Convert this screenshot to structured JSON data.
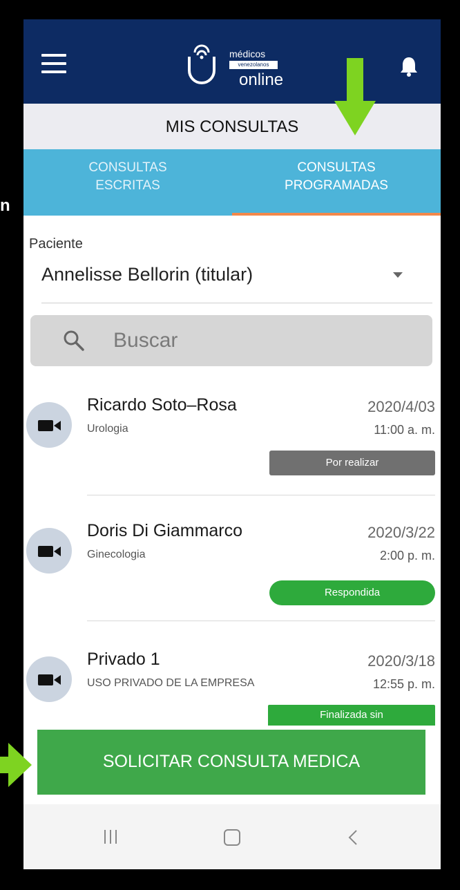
{
  "header": {
    "logo_line1": "médicos",
    "logo_badge": "venezolanos",
    "logo_line2": "online",
    "menu_icon": "hamburger-menu-icon",
    "bell_icon": "notification-bell-icon"
  },
  "page_title": "MIS CONSULTAS",
  "tabs": [
    {
      "line1": "CONSULTAS",
      "line2": "ESCRITAS",
      "active": false
    },
    {
      "line1": "CONSULTAS",
      "line2": "PROGRAMADAS",
      "active": true
    }
  ],
  "patient": {
    "label": "Paciente",
    "value": "Annelisse Bellorin (titular)"
  },
  "search": {
    "placeholder": "Buscar"
  },
  "consultations": [
    {
      "name": "Ricardo Soto–Rosa",
      "specialty": "Urologia",
      "date": "2020/4/03",
      "time": "11:00 a. m.",
      "status": "Por realizar",
      "status_color": "#707070"
    },
    {
      "name": "Doris Di Giammarco",
      "specialty": "Ginecologia",
      "date": "2020/3/22",
      "time": "2:00 p. m.",
      "status": "Respondida",
      "status_color": "#2eaa3c"
    },
    {
      "name": "Privado 1",
      "specialty": "USO PRIVADO DE LA EMPRESA",
      "date": "2020/3/18",
      "time": "12:55 p. m.",
      "status": "Finalizada sin",
      "status_color": "#2eaa3c"
    }
  ],
  "cta": {
    "label": "SOLICITAR CONSULTA MEDICA",
    "color": "#3fa84a"
  },
  "colors": {
    "header": "#0d2b63",
    "tabs": "#4db4d9",
    "tab_indicator": "#f3884a",
    "annotation_arrow": "#7ed321"
  },
  "edge_text": "n"
}
